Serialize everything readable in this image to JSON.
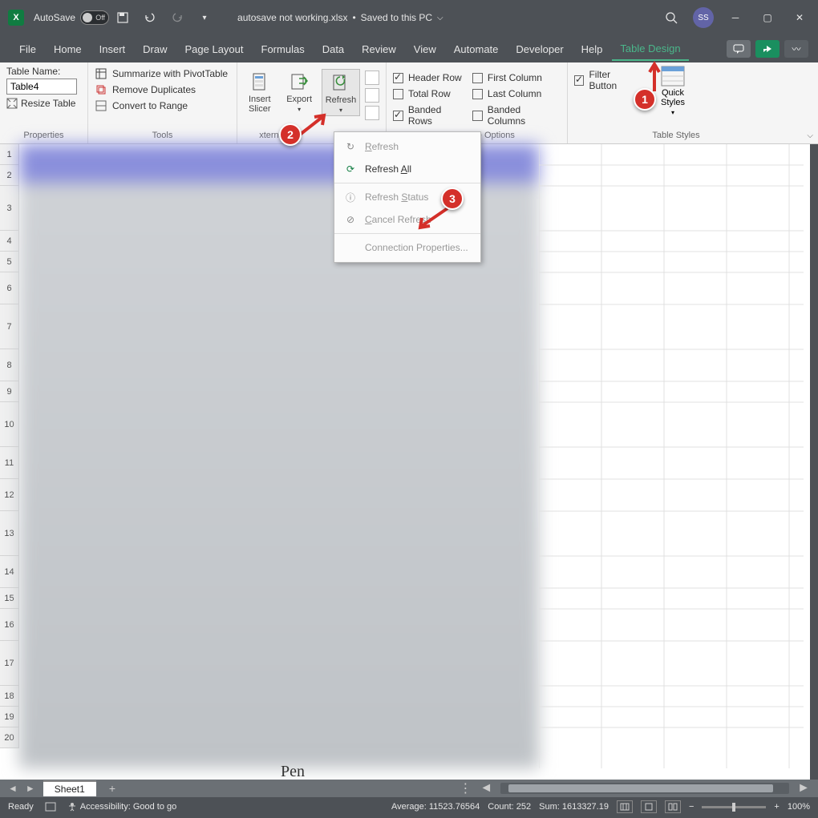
{
  "titlebar": {
    "autosave_label": "AutoSave",
    "autosave_state": "Off",
    "doc_name": "autosave not working.xlsx",
    "save_status": "Saved to this PC",
    "avatar_initials": "SS"
  },
  "tabs": {
    "items": [
      "File",
      "Home",
      "Insert",
      "Draw",
      "Page Layout",
      "Formulas",
      "Data",
      "Review",
      "View",
      "Automate",
      "Developer",
      "Help",
      "Table Design"
    ],
    "active": "Table Design"
  },
  "ribbon": {
    "properties": {
      "label": "Properties",
      "table_name_label": "Table Name:",
      "table_name_value": "Table4",
      "resize_label": "Resize Table"
    },
    "tools": {
      "label": "Tools",
      "summarize": "Summarize with PivotTable",
      "remove_dup": "Remove Duplicates",
      "convert": "Convert to Range"
    },
    "external": {
      "insert_slicer": "Insert Slicer",
      "export": "Export",
      "refresh": "Refresh",
      "group_label": "External Table Data"
    },
    "style_options": {
      "label": "Table Style Options",
      "header_row": "Header Row",
      "total_row": "Total Row",
      "banded_rows": "Banded Rows",
      "first_col": "First Column",
      "last_col": "Last Column",
      "banded_cols": "Banded Columns",
      "filter_btn": "Filter Button"
    },
    "styles": {
      "label": "Table Styles",
      "quick": "Quick Styles"
    }
  },
  "dropdown": {
    "refresh": "Refresh",
    "refresh_all": "Refresh All",
    "refresh_status": "Refresh Status",
    "cancel_refresh": "Cancel Refresh",
    "conn_props": "Connection Properties..."
  },
  "callouts": {
    "one": "1",
    "two": "2",
    "three": "3"
  },
  "sheet": {
    "rows": [
      "1",
      "2",
      "3",
      "4",
      "5",
      "6",
      "7",
      "8",
      "9",
      "10",
      "11",
      "12",
      "13",
      "14",
      "15",
      "16",
      "17",
      "18",
      "19",
      "20"
    ],
    "tab_name": "Sheet1",
    "blur_caption": "Pen"
  },
  "statusbar": {
    "ready": "Ready",
    "accessibility": "Accessibility: Good to go",
    "average": "Average: 11523.76564",
    "count": "Count: 252",
    "sum": "Sum: 1613327.19",
    "zoom": "100%"
  }
}
